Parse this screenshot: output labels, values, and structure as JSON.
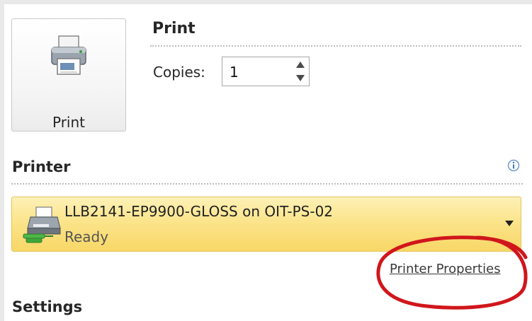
{
  "print": {
    "button_label": "Print",
    "heading": "Print",
    "copies_label": "Copies:",
    "copies_value": "1"
  },
  "printer": {
    "heading": "Printer",
    "selected_name": "LLB2141-EP9900-GLOSS on OIT-PS-02",
    "selected_status": "Ready",
    "properties_link": "Printer Properties",
    "info_icon": "info-icon"
  },
  "settings": {
    "heading": "Settings"
  },
  "colors": {
    "dropdown_highlight": "#fbe48b",
    "annotation": "#d0161c"
  }
}
